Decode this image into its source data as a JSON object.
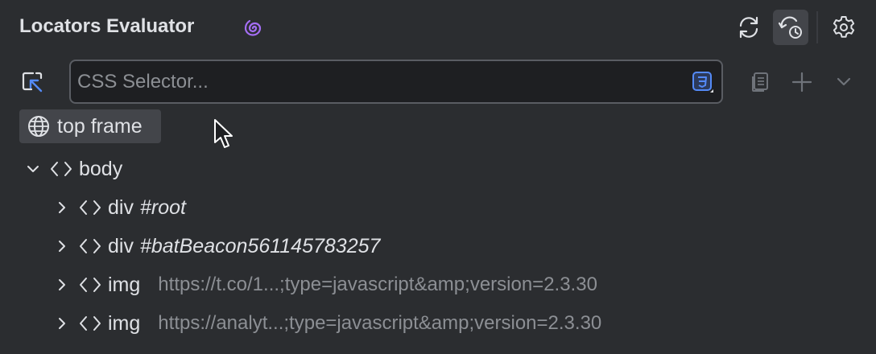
{
  "header": {
    "title": "Locators Evaluator",
    "brand_icon": "spiral-logo-icon",
    "buttons": [
      "sync-icon",
      "history-icon",
      "gear-icon"
    ]
  },
  "search": {
    "placeholder": "CSS Selector...",
    "value": "",
    "type_icon": "css3-icon"
  },
  "toolbar": {
    "pick_icon": "pick-element-icon",
    "copy_icon": "copy-icon",
    "add_icon": "plus-icon",
    "more_icon": "chevron-down-icon"
  },
  "frame": {
    "label": "top frame",
    "icon": "globe-icon"
  },
  "tree": {
    "nodes": [
      {
        "tag": "body",
        "id": "",
        "attr": "",
        "expanded": true
      },
      {
        "tag": "div",
        "id": "#root",
        "attr": "",
        "expanded": false
      },
      {
        "tag": "div",
        "id": "#batBeacon561145783257",
        "attr": "",
        "expanded": false
      },
      {
        "tag": "img",
        "id": "",
        "attr": "https://t.co/1...;type=javascript&amp;version=2.3.30",
        "expanded": false
      },
      {
        "tag": "img",
        "id": "",
        "attr": "https://analyt...;type=javascript&amp;version=2.3.30",
        "expanded": false
      }
    ]
  },
  "colors": {
    "background": "#2b2d30",
    "text": "#dfe1e5",
    "muted": "#8c8f94",
    "accent_blue": "#548af7",
    "brand_purple": "#a46ef4"
  }
}
